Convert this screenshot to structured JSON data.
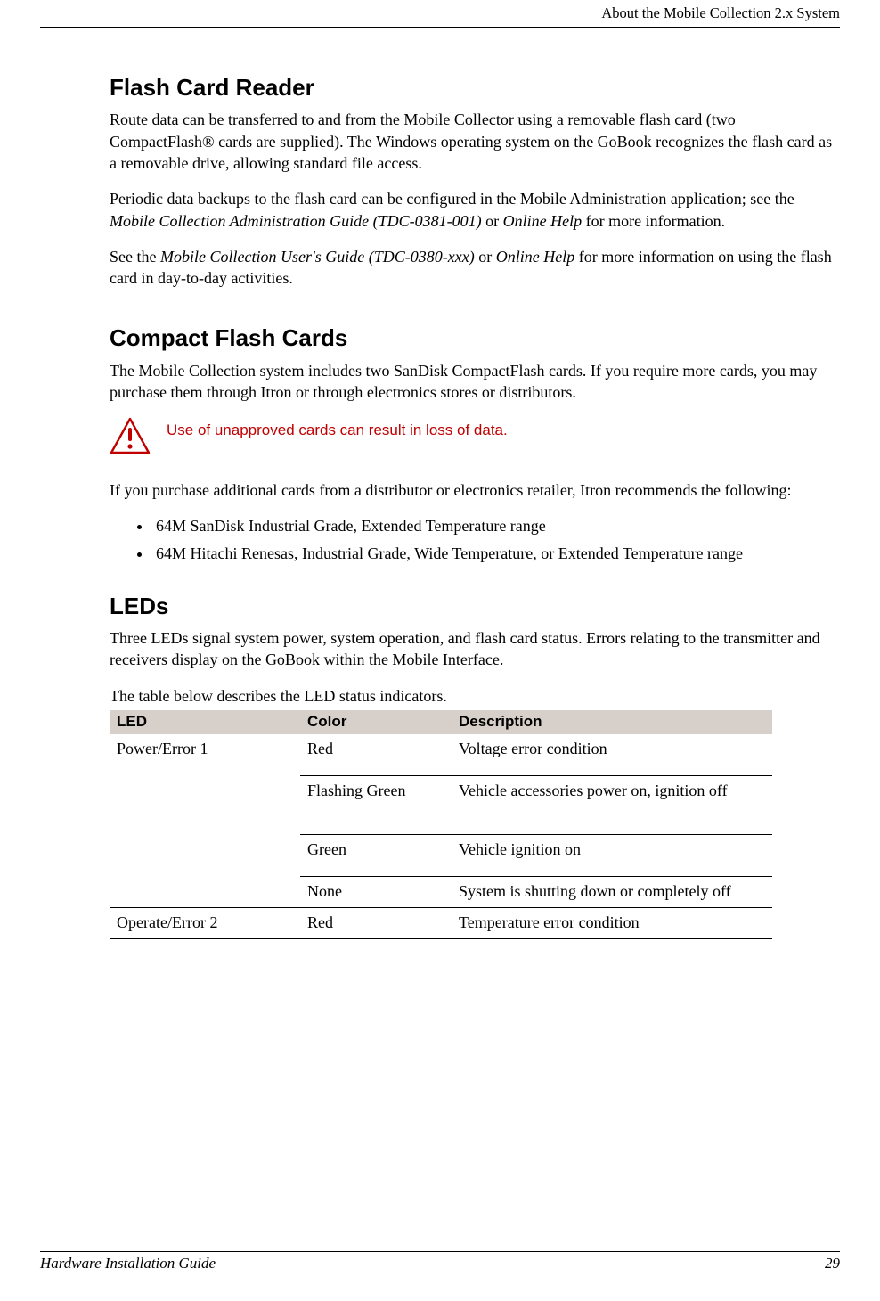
{
  "header": {
    "running_title": "About the Mobile Collection 2.x System"
  },
  "sections": {
    "flash_card_reader": {
      "title": "Flash Card Reader",
      "p1": "Route data can be transferred to and from the Mobile Collector using a removable flash card (two CompactFlash® cards are supplied). The Windows operating system on the GoBook recognizes the flash card as a removable drive, allowing standard file access.",
      "p2_a": "Periodic data backups to the flash card can be configured in the Mobile Administration application; see the ",
      "p2_ref1": "Mobile Collection Administration Guide (TDC-0381-001)",
      "p2_b": " or ",
      "p2_ref2": "Online Help",
      "p2_c": " for more information.",
      "p3_a": "See the ",
      "p3_ref1": "Mobile Collection User's Guide (TDC-0380-xxx)",
      "p3_b": " or ",
      "p3_ref2": "Online Help",
      "p3_c": " for more information on using the flash card in day-to-day activities."
    },
    "compact_flash_cards": {
      "title": "Compact Flash Cards",
      "p1": "The Mobile Collection system includes two SanDisk CompactFlash cards. If you require more cards, you may purchase them through Itron or through electronics stores or distributors.",
      "warning": "Use of unapproved cards can result in loss of data.",
      "p2": " If you purchase additional cards from a distributor or electronics retailer, Itron recommends the following:",
      "bullets": [
        "64M SanDisk Industrial Grade, Extended Temperature range",
        "64M Hitachi Renesas, Industrial Grade, Wide Temperature, or Extended Temperature range"
      ]
    },
    "leds": {
      "title": "LEDs",
      "p1": "Three LEDs signal system power, system operation, and flash card status. Errors relating to the transmitter and receivers display on the GoBook within the Mobile Interface.",
      "p2": "The table below describes the LED status indicators.",
      "table": {
        "headers": {
          "led": "LED",
          "color": "Color",
          "description": "Description"
        },
        "rows": [
          {
            "led": "Power/Error 1",
            "color": "Red",
            "description": "Voltage error condition"
          },
          {
            "led": "",
            "color": "Flashing Green",
            "description": "Vehicle accessories power on, ignition off"
          },
          {
            "led": "",
            "color": "Green",
            "description": "Vehicle ignition on"
          },
          {
            "led": "",
            "color": "None",
            "description": "System is shutting down or completely off"
          },
          {
            "led": "Operate/Error 2",
            "color": "Red",
            "description": "Temperature error condition"
          }
        ]
      }
    }
  },
  "footer": {
    "left": "Hardware Installation Guide",
    "right": "29"
  }
}
